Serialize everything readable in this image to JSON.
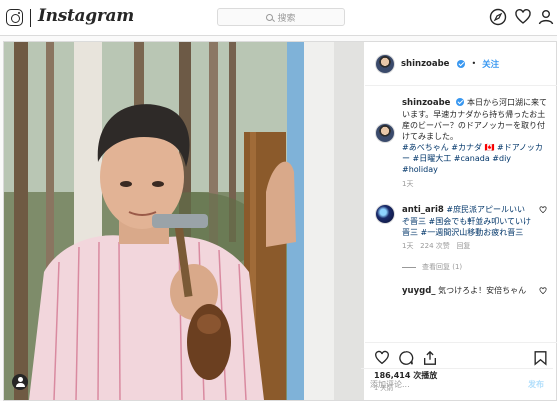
{
  "app": {
    "name": "Instagram"
  },
  "search": {
    "placeholder": "搜索"
  },
  "nav": {
    "icons": [
      "compass-icon",
      "heart-icon",
      "profile-icon"
    ]
  },
  "post": {
    "author": "shinzoabe",
    "follow_label": "关注",
    "caption": {
      "author": "shinzoabe",
      "text": "本日から河口湖に来ています。早速カナダから持ち帰ったお土産のビーバー？のドアノッカーを取り付けてみました。",
      "tags": "#あべちゃん #カナダ 🇨🇦 #ドアノッカー #日曜大工 #canada #diy #holiday",
      "time": "1天"
    },
    "comments": [
      {
        "author": "anti_ari8",
        "text": "#庶民派アピールいいぞ晋三 #国会でも軒並み叩いていけ晋三 #一週間沢山移動お疲れ晋三",
        "time": "1天",
        "likes": "224 次赞",
        "reply_label": "回复",
        "view_replies": "查看回复 (1)"
      },
      {
        "author": "yuygd_",
        "text": "気つけろよ！安倍ちゃん"
      }
    ],
    "views": "186,414 次播放",
    "posted": "1 天前",
    "add_comment_placeholder": "添加评论...",
    "post_button": "发布"
  },
  "colors": {
    "accent": "#3897f0",
    "border": "#dbdbdb",
    "muted": "#999999"
  }
}
